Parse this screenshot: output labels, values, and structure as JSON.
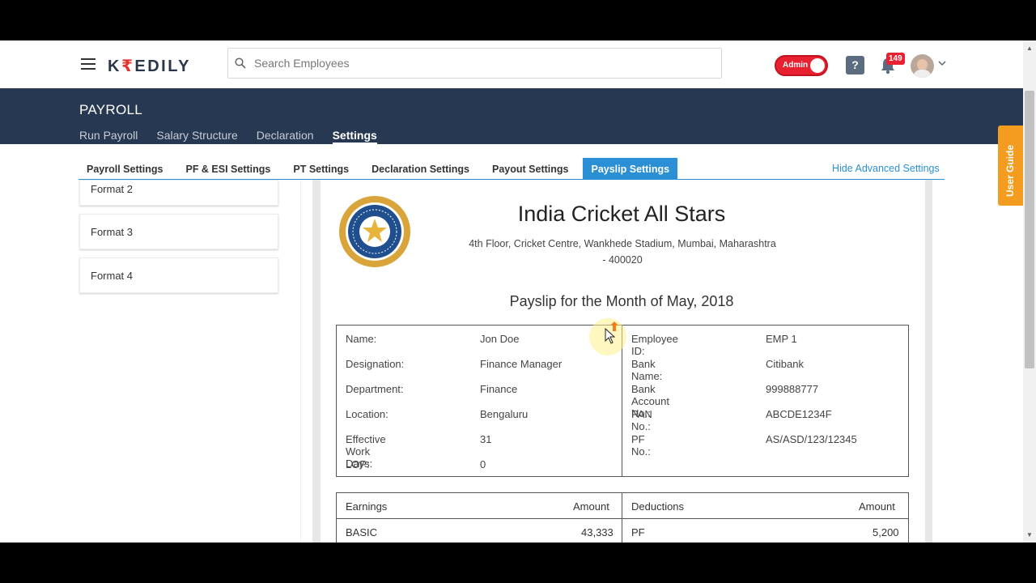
{
  "app": {
    "logo_prefix": "K",
    "logo_symbol": "₹",
    "logo_suffix": "EDILY"
  },
  "search": {
    "placeholder": "Search Employees"
  },
  "header": {
    "admin_label": "Admin",
    "help_label": "?",
    "notification_count": "149"
  },
  "section": {
    "title": "PAYROLL"
  },
  "nav": [
    "Run Payroll",
    "Salary Structure",
    "Declaration",
    "Settings"
  ],
  "nav_active": "Settings",
  "tabs": [
    "Payroll Settings",
    "PF & ESI Settings",
    "PT Settings",
    "Declaration Settings",
    "Payout Settings",
    "Payslip Settings"
  ],
  "tab_active": "Payslip Settings",
  "hide_advanced": "Hide Advanced Settings",
  "user_guide": "User Guide",
  "formats": [
    "Format 2",
    "Format 3",
    "Format 4"
  ],
  "payslip": {
    "company": "India Cricket All Stars",
    "address_line1": "4th Floor, Cricket Centre, Wankhede Stadium, Mumbai, Maharashtra",
    "address_line2": "- 400020",
    "title": "Payslip for the Month of May, 2018",
    "left": [
      {
        "k": "Name:",
        "v": "Jon Doe"
      },
      {
        "k": "Designation:",
        "v": "Finance Manager"
      },
      {
        "k": "Department:",
        "v": "Finance"
      },
      {
        "k": "Location:",
        "v": "Bengaluru"
      },
      {
        "k": "Effective Work Days:",
        "v": "31"
      },
      {
        "k": "LOP:",
        "v": "0"
      }
    ],
    "right": [
      {
        "k": "Employee ID:",
        "v": "EMP 1"
      },
      {
        "k": "Bank Name:",
        "v": "Citibank"
      },
      {
        "k": "Bank Account No.:",
        "v": "999888777"
      },
      {
        "k": "PAN No.:",
        "v": "ABCDE1234F"
      },
      {
        "k": "PF No.:",
        "v": "AS/ASD/123/12345"
      }
    ],
    "earnings_header": "Earnings",
    "amount_header": "Amount",
    "deductions_header": "Deductions",
    "earnings_row": {
      "label": "BASIC",
      "amount": "43,333"
    },
    "deductions_row": {
      "label": "PF",
      "amount": "5,200"
    }
  },
  "colors": {
    "navy": "#273852",
    "accent_blue": "#2b8fd6",
    "admin_red": "#e8202f",
    "guide_orange": "#f39c1f"
  }
}
